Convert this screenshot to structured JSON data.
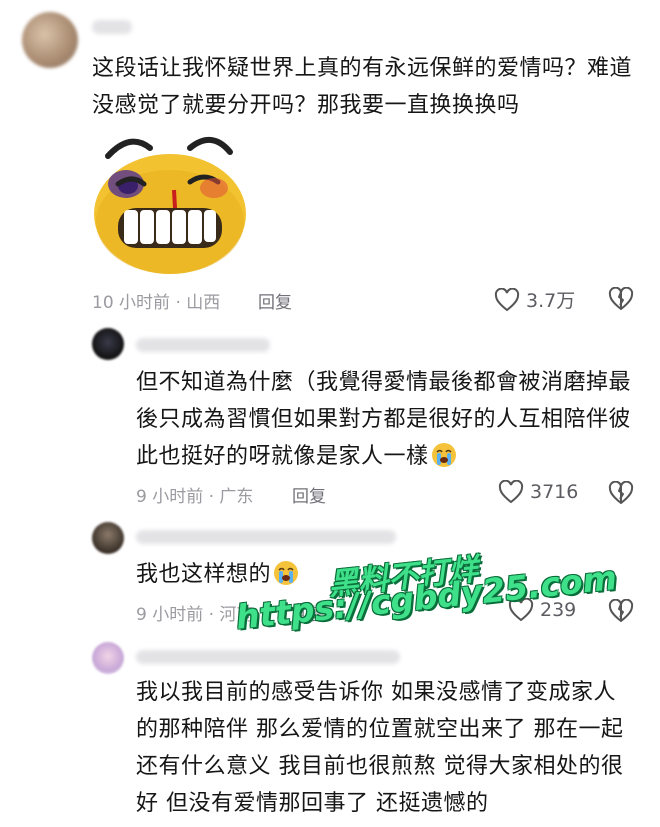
{
  "comments": [
    {
      "text": "这段话让我怀疑世界上真的有永远保鲜的爱情吗？难道\n没感觉了就要分开吗？那我要一直换换换吗",
      "time_location": "10 小时前 · 山西",
      "reply_label": "回复",
      "like_count": "3.7万"
    },
    {
      "text": "但不知道為什麼（我覺得愛情最後都會被消磨掉最\n後只成為習慣但如果對方都是很好的人互相陪伴彼\n此也挺好的呀就像是家人一樣",
      "time_location": "9 小时前 · 广东",
      "reply_label": "回复",
      "like_count": "3716"
    },
    {
      "text": "我也这样想的",
      "time_location": "9 小时前 · 河南",
      "reply_label": "回复",
      "like_count": "239"
    },
    {
      "text": "我以我目前的感受告诉你 如果没感情了变成家人\n的那种陪伴 那么爱情的位置就空出来了 那在一起\n还有什么意义 我目前也很煎熬 觉得大家相处的很\n好 但没有爱情那回事了 还挺遗憾的"
    }
  ],
  "watermark": {
    "line1": "黑料不打烊",
    "line2": "https://cgbdy25.com"
  },
  "icons": {
    "like": "heart-outline-icon",
    "dislike": "broken-heart-icon",
    "crying_emoji": "loudly-crying-face-icon",
    "sticker": "grinning-bruised-face-sticker"
  },
  "colors": {
    "text": "#161616",
    "meta": "#9a9aa0",
    "watermark": "#3fe08a"
  }
}
